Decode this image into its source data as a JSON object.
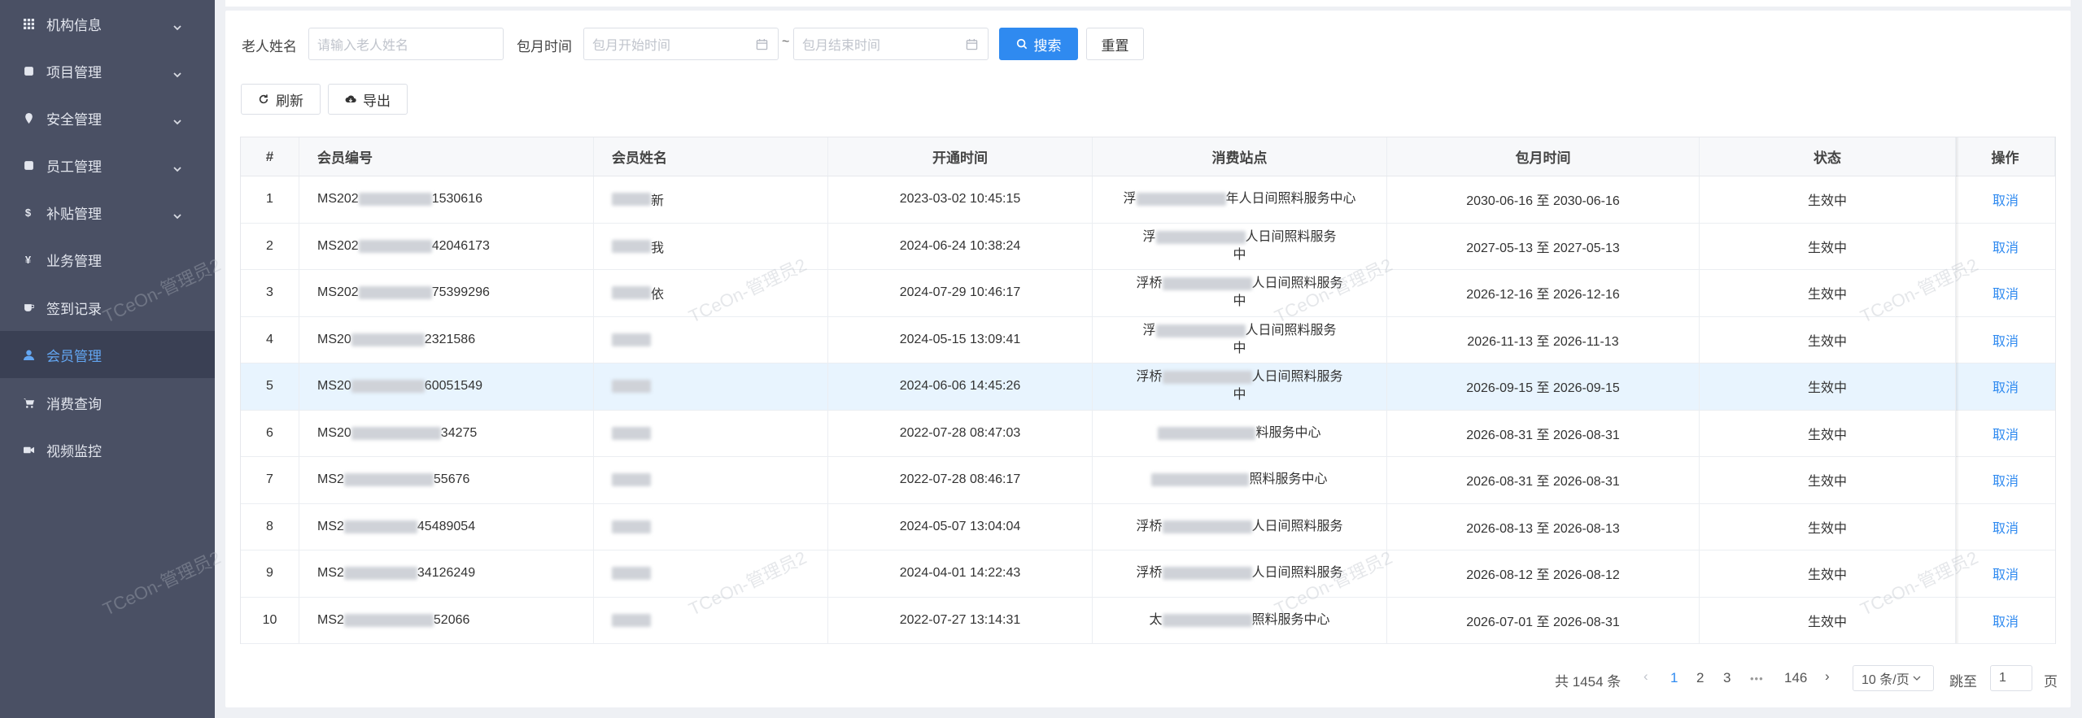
{
  "sidebar": {
    "items": [
      {
        "label": "机构信息",
        "icon": "grid-icon",
        "has_arrow": true
      },
      {
        "label": "项目管理",
        "icon": "doc-icon",
        "has_arrow": true
      },
      {
        "label": "安全管理",
        "icon": "location-icon",
        "has_arrow": true
      },
      {
        "label": "员工管理",
        "icon": "doc-icon",
        "has_arrow": true
      },
      {
        "label": "补贴管理",
        "icon": "dollar-icon",
        "has_arrow": true
      },
      {
        "label": "业务管理",
        "icon": "yen-icon",
        "has_arrow": false
      },
      {
        "label": "签到记录",
        "icon": "cup-icon",
        "has_arrow": false
      },
      {
        "label": "会员管理",
        "icon": "user-icon",
        "has_arrow": false,
        "active": true
      },
      {
        "label": "消费查询",
        "icon": "cart-icon",
        "has_arrow": false
      },
      {
        "label": "视频监控",
        "icon": "video-icon",
        "has_arrow": false
      }
    ],
    "active_color": "#63a6f2"
  },
  "search": {
    "name_label": "老人姓名",
    "name_placeholder": "请输入老人姓名",
    "time_label": "包月时间",
    "start_placeholder": "包月开始时间",
    "separator": "~",
    "end_placeholder": "包月结束时间",
    "search_label": "搜索",
    "reset_label": "重置"
  },
  "toolbar": {
    "refresh_label": "刷新",
    "export_label": "导出"
  },
  "table": {
    "columns": [
      "#",
      "会员编号",
      "会员姓名",
      "开通时间",
      "消费站点",
      "包月时间",
      "状态",
      "操作"
    ],
    "rows": [
      {
        "index": "1",
        "id_prefix": "MS202",
        "id_suffix": "1530616",
        "name_end": "新",
        "open_time": "2023-03-02 10:45:15",
        "station_prefix": "浮",
        "station_suffix": "年人日间照料服务中心",
        "station_wrap": "",
        "month_range": "2030-06-16 至 2030-06-16",
        "status": "生效中",
        "action": "取消"
      },
      {
        "index": "2",
        "id_prefix": "MS202",
        "id_suffix": "42046173",
        "name_end": "我",
        "open_time": "2024-06-24 10:38:24",
        "station_prefix": "浮",
        "station_suffix": "人日间照料服务",
        "station_wrap": "中",
        "month_range": "2027-05-13 至 2027-05-13",
        "status": "生效中",
        "action": "取消"
      },
      {
        "index": "3",
        "id_prefix": "MS202",
        "id_suffix": "75399296",
        "name_end": "依",
        "open_time": "2024-07-29 10:46:17",
        "station_prefix": "浮桥",
        "station_suffix": "人日间照料服务",
        "station_wrap": "中",
        "month_range": "2026-12-16 至 2026-12-16",
        "status": "生效中",
        "action": "取消"
      },
      {
        "index": "4",
        "id_prefix": "MS20",
        "id_suffix": "2321586",
        "name_end": "",
        "open_time": "2024-05-15 13:09:41",
        "station_prefix": "浮",
        "station_suffix": "人日间照料服务",
        "station_wrap": "中",
        "month_range": "2026-11-13 至 2026-11-13",
        "status": "生效中",
        "action": "取消"
      },
      {
        "index": "5",
        "id_prefix": "MS20",
        "id_suffix": "60051549",
        "name_end": "",
        "open_time": "2024-06-06 14:45:26",
        "station_prefix": "浮桥",
        "station_suffix": "人日间照料服务",
        "station_wrap": "中",
        "month_range": "2026-09-15 至 2026-09-15",
        "status": "生效中",
        "action": "取消"
      },
      {
        "index": "6",
        "id_prefix": "MS20",
        "id_suffix": "34275",
        "name_end": "",
        "open_time": "2022-07-28 08:47:03",
        "station_prefix": "",
        "station_suffix": "料服务中心",
        "station_wrap": "",
        "month_range": "2026-08-31 至 2026-08-31",
        "status": "生效中",
        "action": "取消"
      },
      {
        "index": "7",
        "id_prefix": "MS2",
        "id_suffix": "55676",
        "name_end": "",
        "open_time": "2022-07-28 08:46:17",
        "station_prefix": "",
        "station_suffix": "照料服务中心",
        "station_wrap": "",
        "month_range": "2026-08-31 至 2026-08-31",
        "status": "生效中",
        "action": "取消"
      },
      {
        "index": "8",
        "id_prefix": "MS2",
        "id_suffix": "45489054",
        "name_end": "",
        "open_time": "2024-05-07 13:04:04",
        "station_prefix": "浮桥",
        "station_suffix": "人日间照料服务",
        "station_wrap": "",
        "month_range": "2026-08-13 至 2026-08-13",
        "status": "生效中",
        "action": "取消"
      },
      {
        "index": "9",
        "id_prefix": "MS2",
        "id_suffix": "34126249",
        "name_end": "",
        "open_time": "2024-04-01 14:22:43",
        "station_prefix": "浮桥",
        "station_suffix": "人日间照料服务",
        "station_wrap": "",
        "month_range": "2026-08-12 至 2026-08-12",
        "status": "生效中",
        "action": "取消"
      },
      {
        "index": "10",
        "id_prefix": "MS2",
        "id_suffix": "52066",
        "name_end": "",
        "open_time": "2022-07-27 13:14:31",
        "station_prefix": "太",
        "station_suffix": "照料服务中心",
        "station_wrap": "",
        "month_range": "2026-07-01 至 2026-08-31",
        "status": "生效中",
        "action": "取消"
      }
    ],
    "highlight_row_index": 4
  },
  "pagination": {
    "total": "共 1454 条",
    "prev": "‹",
    "pages": [
      "1",
      "2",
      "3"
    ],
    "ellipsis": "•••",
    "last_page": "146",
    "next": "›",
    "page_size": "10 条/页",
    "goto_label": "跳至",
    "goto_value": "1",
    "page_unit": "页"
  },
  "watermark_text": "TCeOn-管理员2",
  "colors": {
    "primary": "#2f8af0",
    "sidebar_bg": "#4a5064",
    "row_highlight": "#e8f4fe"
  }
}
